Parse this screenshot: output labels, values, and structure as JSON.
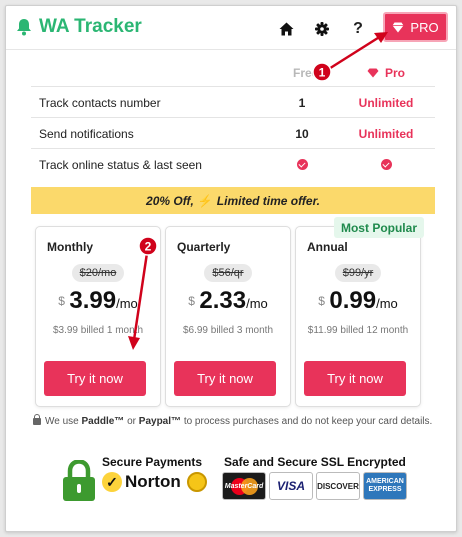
{
  "header": {
    "app_title": "WA Tracker",
    "pro_label": "PRO",
    "help_label": "?"
  },
  "comparison": {
    "col_free": "Free",
    "col_pro": "Pro",
    "rows": [
      {
        "feature": "Track contacts number",
        "free": "1",
        "pro": "Unlimited"
      },
      {
        "feature": "Send notifications",
        "free": "10",
        "pro": "Unlimited"
      },
      {
        "feature": "Track online status & last seen",
        "free": "check",
        "pro": "check"
      }
    ]
  },
  "promo": {
    "discount": "20% Off,",
    "offer": "Limited time offer."
  },
  "plans": [
    {
      "name": "Monthly",
      "old_price": "$20/mo",
      "currency": "$",
      "price": "3.99",
      "period": "/mo",
      "billed": "$3.99 billed 1 month",
      "cta": "Try it now"
    },
    {
      "name": "Quarterly",
      "old_price": "$56/qr",
      "currency": "$",
      "price": "2.33",
      "period": "/mo",
      "billed": "$6.99 billed 3 month",
      "cta": "Try it now"
    },
    {
      "name": "Annual",
      "old_price": "$99/yr",
      "currency": "$",
      "price": "0.99",
      "period": "/mo",
      "billed": "$11.99 billed 12 month",
      "cta": "Try it now",
      "badge": "Most Popular"
    }
  ],
  "note": {
    "prefix": "We use",
    "paddle": "Paddle™",
    "or": "or",
    "paypal": "Paypal™",
    "suffix": "to process purchases and do not keep your card details."
  },
  "trust": {
    "secure_payments": "Secure Payments",
    "norton": "Norton",
    "ssl": "Safe and Secure SSL Encrypted",
    "cards": {
      "mastercard": "MasterCard",
      "visa": "VISA",
      "discover": "DISCOVER",
      "amex": "AMERICAN EXPRESS"
    }
  },
  "annotations": [
    "1",
    "2"
  ],
  "colors": {
    "brand_green": "#2bb673",
    "accent_pink": "#e8335a",
    "promo_yellow": "#fbd96b",
    "annotation_red": "#d0021b"
  }
}
